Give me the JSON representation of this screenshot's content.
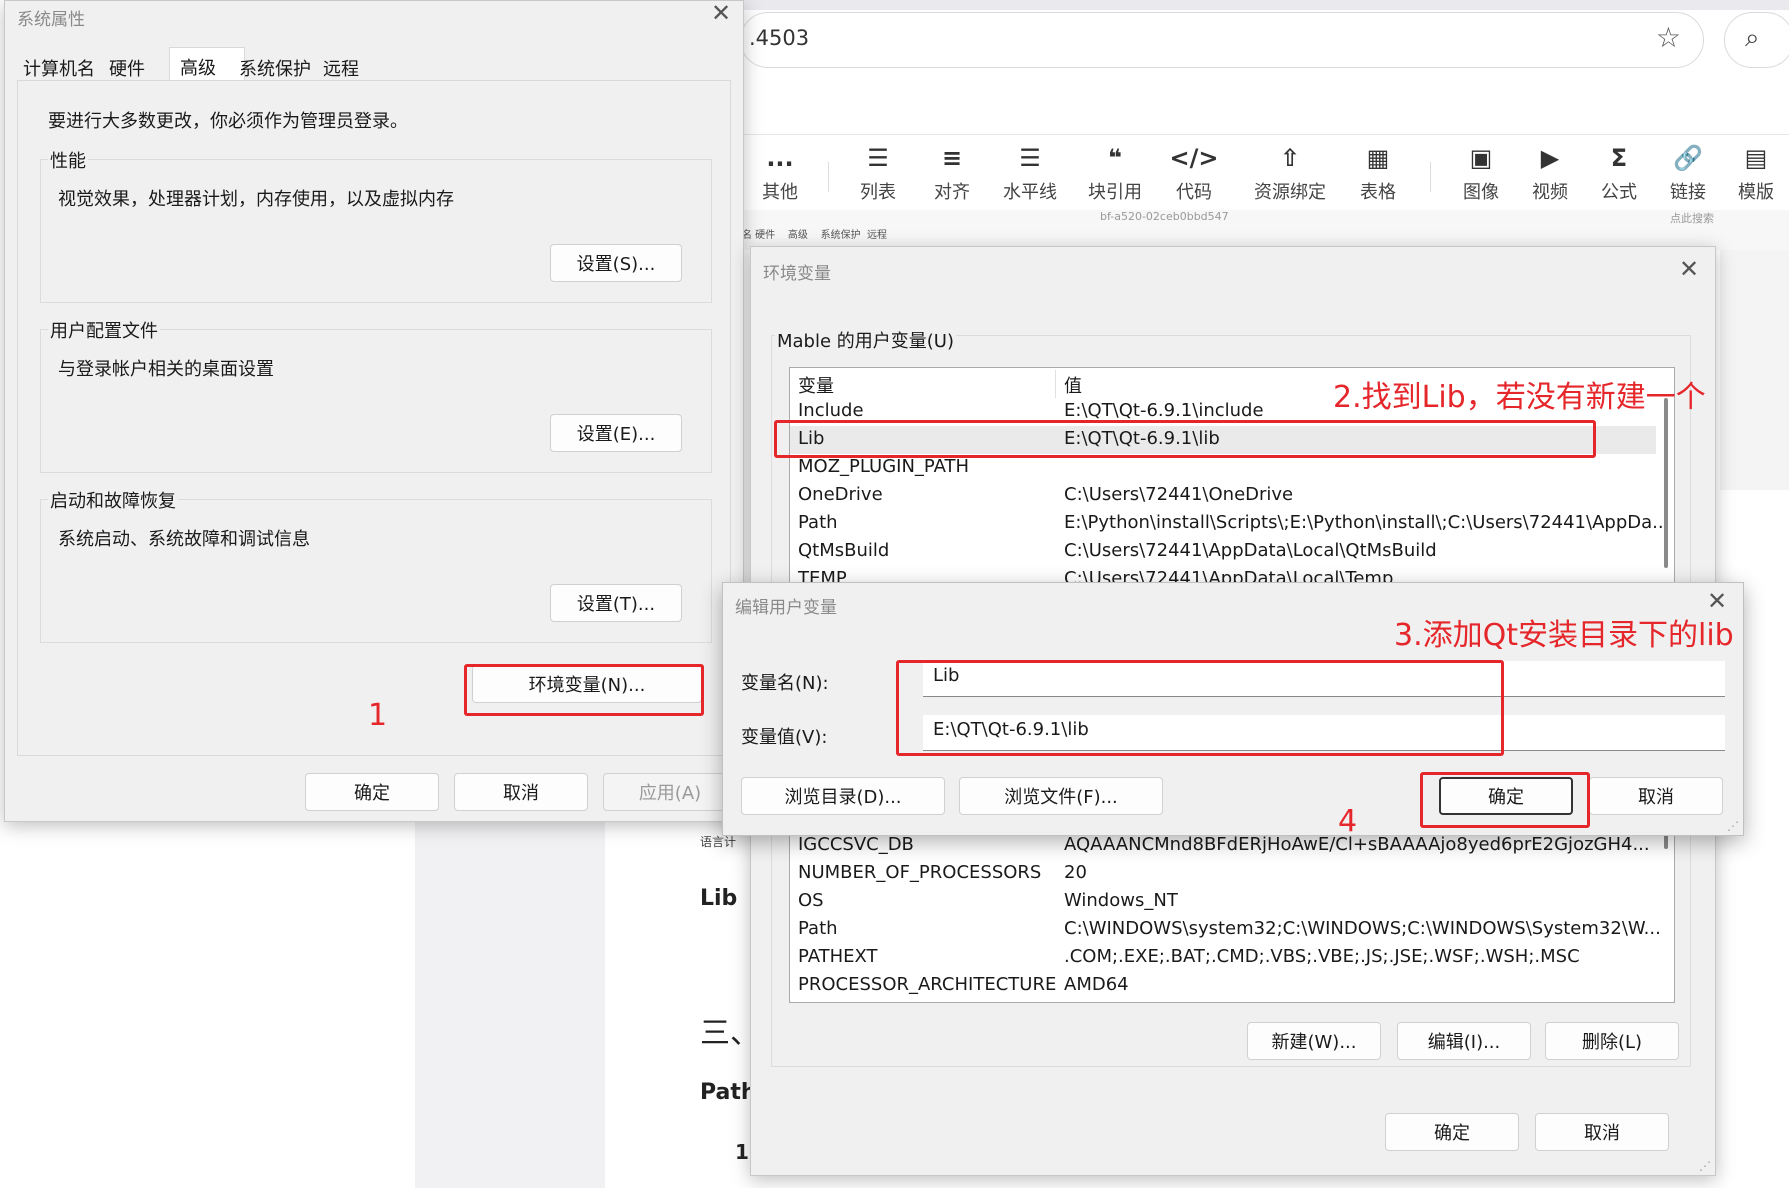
{
  "browser": {
    "address_text": ".4503",
    "star_icon": "star-icon",
    "search_icon": "search-icon"
  },
  "toolbar": {
    "items": [
      {
        "icon": "...",
        "label": "其他"
      },
      {
        "icon": "☰",
        "label": "列表"
      },
      {
        "icon": "≡",
        "label": "对齐"
      },
      {
        "icon": "☰",
        "label": "水平线"
      },
      {
        "icon": "❝",
        "label": "块引用"
      },
      {
        "icon": "</>",
        "label": "代码"
      },
      {
        "icon": "⇧",
        "label": "资源绑定"
      },
      {
        "icon": "▦",
        "label": "表格"
      },
      {
        "icon": "▣",
        "label": "图像"
      },
      {
        "icon": "▶",
        "label": "视频"
      },
      {
        "icon": "Σ",
        "label": "公式"
      },
      {
        "icon": "🔗",
        "label": "链接"
      },
      {
        "icon": "▤",
        "label": "模版"
      }
    ]
  },
  "background_doc": {
    "lib_heading": "Lib",
    "section_three": "三、",
    "path_heading": "Path",
    "num_one": "1",
    "small_note": "语言计",
    "mini_tabs": "名 硬件    高级    系统保护  远程",
    "mini_address": "bf-a520-02ceb0bbd547",
    "mini_search": "点此搜索"
  },
  "sys_props": {
    "title": "系统属性",
    "tabs": [
      "计算机名",
      "硬件",
      "高级",
      "系统保护",
      "远程"
    ],
    "admin_note": "要进行大多数更改，你必须作为管理员登录。",
    "groups": [
      {
        "caption": "性能",
        "desc": "视觉效果，处理器计划，内存使用，以及虚拟内存",
        "button": "设置(S)..."
      },
      {
        "caption": "用户配置文件",
        "desc": "与登录帐户相关的桌面设置",
        "button": "设置(E)..."
      },
      {
        "caption": "启动和故障恢复",
        "desc": "系统启动、系统故障和调试信息",
        "button": "设置(T)..."
      }
    ],
    "env_button": "环境变量(N)...",
    "ok": "确定",
    "cancel": "取消",
    "apply": "应用(A)"
  },
  "env_vars": {
    "title": "环境变量",
    "user_group": "Mable 的用户变量(U)",
    "col_var": "变量",
    "col_val": "值",
    "user_rows": [
      {
        "name": "Include",
        "value": "E:\\QT\\Qt-6.9.1\\include"
      },
      {
        "name": "Lib",
        "value": "E:\\QT\\Qt-6.9.1\\lib"
      },
      {
        "name": "MOZ_PLUGIN_PATH",
        "value": ""
      },
      {
        "name": "OneDrive",
        "value": "C:\\Users\\72441\\OneDrive"
      },
      {
        "name": "Path",
        "value": "E:\\Python\\install\\Scripts\\;E:\\Python\\install\\;C:\\Users\\72441\\AppDa..."
      },
      {
        "name": "QtMsBuild",
        "value": "C:\\Users\\72441\\AppData\\Local\\QtMsBuild"
      },
      {
        "name": "TEMP",
        "value": "C:\\Users\\72441\\AppData\\Local\\Temp"
      }
    ],
    "sys_rows": [
      {
        "name": "IGCCSVC_DB",
        "value": "AQAAANCMnd8BFdERjHoAwE/Cl+sBAAAAjo8yed6prE2GjozGH4..."
      },
      {
        "name": "NUMBER_OF_PROCESSORS",
        "value": "20"
      },
      {
        "name": "OS",
        "value": "Windows_NT"
      },
      {
        "name": "Path",
        "value": "C:\\WINDOWS\\system32;C:\\WINDOWS;C:\\WINDOWS\\System32\\W..."
      },
      {
        "name": "PATHEXT",
        "value": ".COM;.EXE;.BAT;.CMD;.VBS;.VBE;.JS;.JSE;.WSF;.WSH;.MSC"
      },
      {
        "name": "PROCESSOR_ARCHITECTURE",
        "value": "AMD64"
      }
    ],
    "new_btn": "新建(W)...",
    "edit_btn": "编辑(I)...",
    "delete_btn": "删除(L)",
    "ok": "确定",
    "cancel": "取消"
  },
  "edit_var": {
    "title": "编辑用户变量",
    "name_label": "变量名(N):",
    "value_label": "变量值(V):",
    "name_value": "Lib",
    "value_value": "E:\\QT\\Qt-6.9.1\\lib",
    "browse_dir": "浏览目录(D)...",
    "browse_file": "浏览文件(F)...",
    "ok": "确定",
    "cancel": "取消"
  },
  "annotations": {
    "step1": "1",
    "step2": "2.找到Lib，若没有新建一个",
    "step3": "3.添加Qt安装目录下的lib",
    "step4": "4",
    "color": "#e5262a"
  }
}
